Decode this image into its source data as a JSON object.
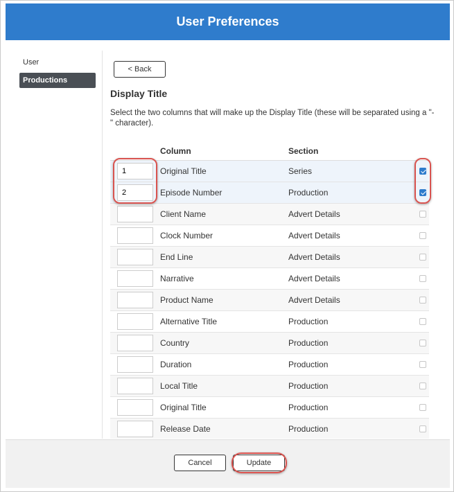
{
  "window": {
    "title": "User Preferences"
  },
  "sidebar": {
    "items": [
      {
        "label": "User",
        "active": false
      },
      {
        "label": "Productions",
        "active": true
      }
    ]
  },
  "main": {
    "back_label": "< Back",
    "heading": "Display Title",
    "description": "Select the two columns that will make up the Display Title (these will be separated using a \"-\" character).",
    "table": {
      "headers": {
        "order": "",
        "column": "Column",
        "section": "Section"
      },
      "rows": [
        {
          "order": "1",
          "column": "Original Title",
          "section": "Series",
          "checked": true
        },
        {
          "order": "2",
          "column": "Episode Number",
          "section": "Production",
          "checked": true
        },
        {
          "order": "",
          "column": "Client Name",
          "section": "Advert Details",
          "checked": false
        },
        {
          "order": "",
          "column": "Clock Number",
          "section": "Advert Details",
          "checked": false
        },
        {
          "order": "",
          "column": "End Line",
          "section": "Advert Details",
          "checked": false
        },
        {
          "order": "",
          "column": "Narrative",
          "section": "Advert Details",
          "checked": false
        },
        {
          "order": "",
          "column": "Product Name",
          "section": "Advert Details",
          "checked": false
        },
        {
          "order": "",
          "column": "Alternative Title",
          "section": "Production",
          "checked": false
        },
        {
          "order": "",
          "column": "Country",
          "section": "Production",
          "checked": false
        },
        {
          "order": "",
          "column": "Duration",
          "section": "Production",
          "checked": false
        },
        {
          "order": "",
          "column": "Local Title",
          "section": "Production",
          "checked": false
        },
        {
          "order": "",
          "column": "Original Title",
          "section": "Production",
          "checked": false
        },
        {
          "order": "",
          "column": "Release Date",
          "section": "Production",
          "checked": false
        }
      ]
    }
  },
  "footer": {
    "cancel_label": "Cancel",
    "update_label": "Update"
  },
  "colors": {
    "header_blue": "#2f7ccc",
    "active_sidebar": "#4a4f55",
    "annotation_red": "#d9534f",
    "checkbox_checked": "#2f7ccc"
  }
}
